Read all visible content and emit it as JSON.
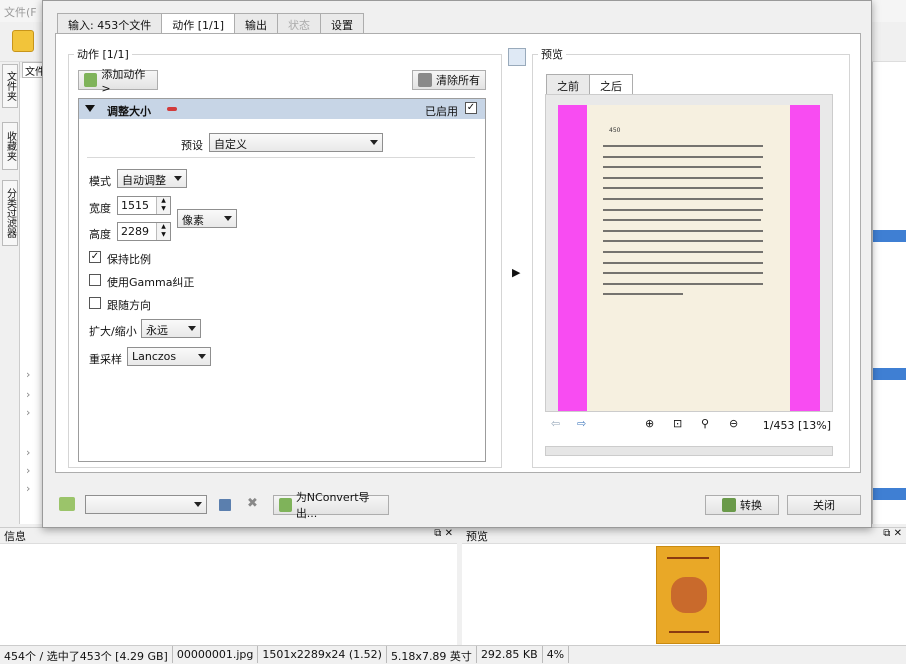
{
  "bg": {
    "menu_file": "文件(F",
    "file_tab": "文件",
    "side_tabs": [
      "文件夹",
      "收藏夹",
      "分类过滤器"
    ]
  },
  "dialog": {
    "tabs": [
      {
        "label": "输入: 453个文件",
        "state": "normal"
      },
      {
        "label": "动作 [1/1]",
        "state": "active"
      },
      {
        "label": "输出",
        "state": "normal"
      },
      {
        "label": "状态",
        "state": "disabled"
      },
      {
        "label": "设置",
        "state": "normal"
      }
    ],
    "actions_group_label": "动作 [1/1]",
    "add_action_label": "添加动作>",
    "clear_all_label": "清除所有",
    "action": {
      "title": "调整大小",
      "enabled_label": "已启用",
      "enabled": true,
      "preset_label": "预设",
      "preset_value": "自定义",
      "mode_label": "模式",
      "mode_value": "自动调整",
      "width_label": "宽度",
      "width_value": "1515",
      "height_label": "高度",
      "height_value": "2289",
      "unit_value": "像素",
      "keep_ratio_label": "保持比例",
      "keep_ratio": true,
      "gamma_label": "使用Gamma纠正",
      "gamma": false,
      "orientation_label": "跟随方向",
      "orientation": false,
      "scale_label": "扩大/缩小",
      "scale_value": "永远",
      "resample_label": "重采样",
      "resample_value": "Lanczos"
    },
    "preview": {
      "group_label": "预览",
      "tabs": [
        {
          "label": "之前",
          "state": "normal"
        },
        {
          "label": "之后",
          "state": "active"
        }
      ],
      "page_number": "450",
      "counter": "1/453 [13%]"
    },
    "footer": {
      "export_label": "为NConvert导出...",
      "convert_label": "转换",
      "close_label": "关闭"
    }
  },
  "panels": {
    "info_title": "信息",
    "preview_title": "预览"
  },
  "status": {
    "selection": "454个 / 选中了453个 [4.29 GB]",
    "filename": "00000001.jpg",
    "dimensions": "1501x2289x24 (1.52)",
    "print_size": "5.18x7.89 英寸",
    "file_size": "292.85 KB",
    "zoom": "4%"
  }
}
